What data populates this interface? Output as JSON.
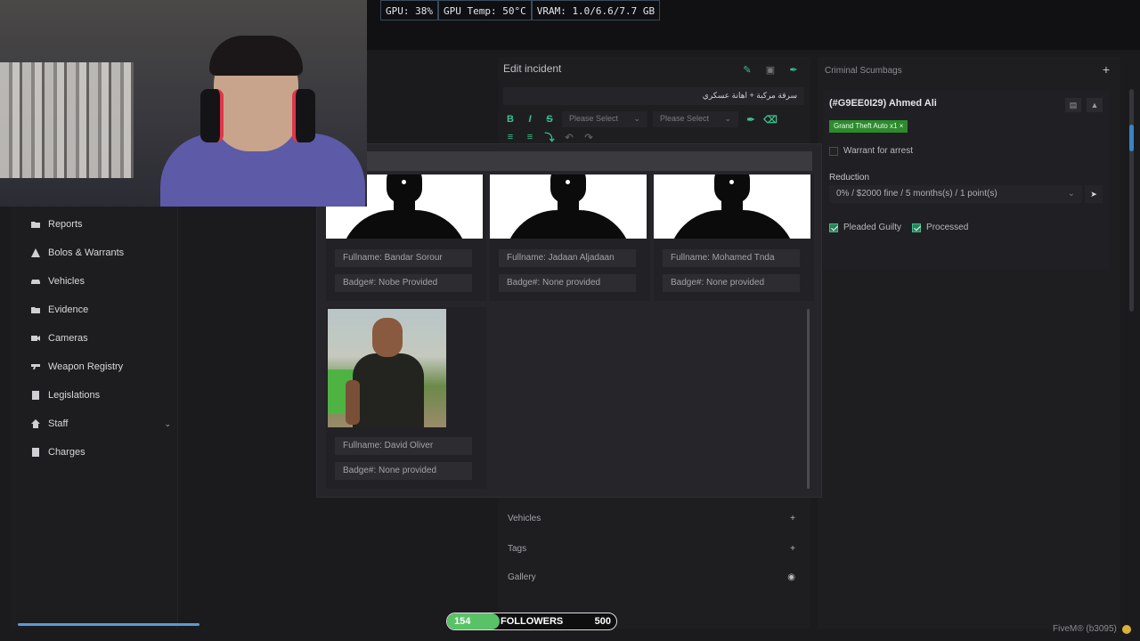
{
  "stats": {
    "gpu": "GPU: 38%",
    "gpu_temp": "GPU Temp: 50°C",
    "vram": "VRAM: 1.0/6.6/7.7 GB"
  },
  "sidebar": {
    "items": [
      {
        "label": "Reports",
        "icon": "folder-icon"
      },
      {
        "label": "Bolos & Warrants",
        "icon": "warning-icon"
      },
      {
        "label": "Vehicles",
        "icon": "car-icon"
      },
      {
        "label": "Evidence",
        "icon": "folder-icon"
      },
      {
        "label": "Cameras",
        "icon": "camera-icon"
      },
      {
        "label": "Weapon Registry",
        "icon": "gun-icon"
      },
      {
        "label": "Legislations",
        "icon": "book-icon"
      },
      {
        "label": "Staff",
        "icon": "home-icon"
      },
      {
        "label": "Charges",
        "icon": "book-icon"
      }
    ]
  },
  "edit_incident": {
    "title": "Edit incident",
    "incident_title_value": "سرقة مركبة + اهانة عسكري",
    "select1_placeholder": "Please Select",
    "select2_placeholder": "Please Select",
    "sections": {
      "vehicles": "Vehicles",
      "tags": "Tags",
      "gallery": "Gallery"
    }
  },
  "officers_modal": {
    "officers": [
      {
        "fullname": "Fullname: Bandar Sorour",
        "badge": "Badge#: Nobe Provided"
      },
      {
        "fullname": "Fullname: Jadaan Aljadaan",
        "badge": "Badge#: None provided"
      },
      {
        "fullname": "Fullname: Mohamed Tnda",
        "badge": "Badge#: None provided"
      },
      {
        "fullname": "Fullname: David Oliver",
        "badge": "Badge#: None provided"
      }
    ]
  },
  "criminals": {
    "heading": "Criminal Scumbags",
    "name": "(#G9EE0I29) Ahmed Ali",
    "charge_chip": "Grand Theft Auto x1",
    "warrant_label": "Warrant for arrest",
    "warrant_checked": false,
    "reduction_label": "Reduction",
    "reduction_value": "0% / $2000 fine / 5 months(s) / 1 point(s)",
    "pleaded_guilty_label": "Pleaded Guilty",
    "pleaded_guilty_checked": true,
    "processed_label": "Processed",
    "processed_checked": true
  },
  "followers": {
    "current": "154",
    "label": "FOLLOWERS",
    "goal": "500",
    "progress": 0.308
  },
  "footer": {
    "fivem": "FiveM® (b3095)"
  },
  "colors": {
    "accent": "#3cc08a",
    "charge_chip": "#2d8a2d",
    "followers_fill": "#59c267"
  }
}
